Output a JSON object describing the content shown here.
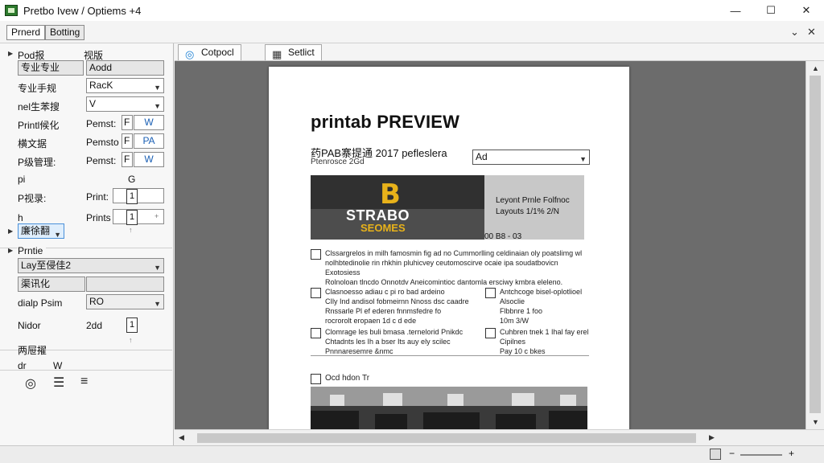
{
  "window": {
    "title": "Pretbo Ivew / Optiems +4",
    "minimize": "—",
    "maximize": "☐",
    "close": "✕"
  },
  "toptabs": [
    {
      "label": "Prnerd"
    },
    {
      "label": "Botting"
    }
  ],
  "pane_controls": {
    "dropdown": "⌄",
    "close": "✕"
  },
  "left": {
    "section1": "Pod报",
    "section1_right": "视版",
    "rows": [
      {
        "label": "专业专业",
        "value": "Aodd"
      },
      {
        "label": "专业手规",
        "value": "RacK"
      },
      {
        "label": "nel生苯搜",
        "value": "V"
      },
      {
        "label": "Printl候化",
        "mid": "Pemst:",
        "a": "F",
        "b": "W"
      },
      {
        "label": "横文据",
        "mid": "Pemsto",
        "a": "F",
        "b": "PA"
      },
      {
        "label": "P级管理:",
        "mid": "Pemst:",
        "a": "F",
        "b": "W"
      }
    ],
    "p_label": "pi",
    "p_symbol": "G",
    "p_row2_label": "P视录:",
    "p_row2_mid": "Print:",
    "p_row2_value": "1",
    "h_label": "h",
    "h_mid": "Prints",
    "h_value": "1",
    "blue_select": "廉徐翻",
    "section2": "Prntie",
    "layout_value": "Lay至侵佳2",
    "gray_label": "渠讯化",
    "dialp_label": "dialp Psim",
    "dialp_value": "RO",
    "nidor_label": "Nidor",
    "nidor_value": "2dd",
    "nidor_step": "1",
    "final_label": "两屉擢",
    "dr_label": "dr",
    "dr_value": "W"
  },
  "preview_tabs": [
    {
      "label": "Cotpocl",
      "icon": "◎"
    },
    {
      "label": "Setlict",
      "icon": "▦"
    }
  ],
  "doc": {
    "title": "printab PREVIEW",
    "subtitle": "药PAB寨提通 2017 pefleslera",
    "subtitle2": "Ptenrosce 2Gd",
    "select_value": "Ad",
    "banner_big": "B",
    "banner_t1": "STRABO",
    "banner_t2": "SEOMES",
    "side_line1": "Leyont Prnle Folfnoc",
    "side_line2": "Layouts 1/1% 2/N",
    "banner_caption": "00 B8 - 03",
    "items": [
      {
        "text": "Clssargrelos in milh famosmin fig ad no Cummorlling celdinaian oly poatslimg wl\nnolhbtedinolie rin rhkhin pluhicvey ceutomoscirve ocaie ipa soudatbovicn Exotosiess\nRolnoloan tlncdo Onnotdv Aneicomintioc dantomla ersciwy kmbra eleleno."
      },
      {
        "text": "Clasnoesso adiau c pi ro bad ardeino\nCIly Ind andisol fobmeirnn Nnoss dsc caadre\nRnssarle Pl ef ederen fnnmsfedre fo\nrocrorolt eropaen 1d c d ede"
      },
      {
        "text": "Antchcoge bisel-oplotlioel\nAlsoclie\nFlbbnre 1 foo\n10m 3/W"
      },
      {
        "text": "Clomrage les buli bmasa .ternelorid Pnikdc\nChtadnts les Ih a bser Its auy ely scilec\nPnnnaresemre &nmc"
      },
      {
        "text": "Cuhbren tnek 1 Ihal fay erel\nCipilnes\nPay 10 c bkes"
      }
    ],
    "bottom_label": "Ocd hdon Tr"
  },
  "status": {
    "zoom_minus": "−",
    "zoom_plus": "+"
  }
}
